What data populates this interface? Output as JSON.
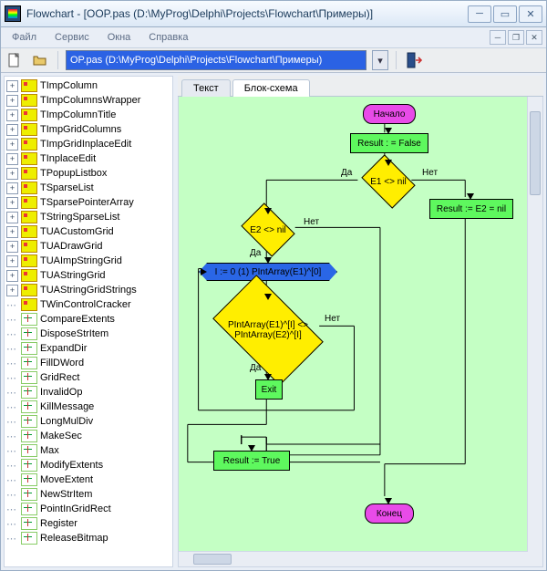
{
  "window": {
    "title": "Flowchart - [OOP.pas (D:\\MyProg\\Delphi\\Projects\\Flowchart\\Примеры)]"
  },
  "menu": {
    "file": "Файл",
    "service": "Сервис",
    "windows": "Окна",
    "help": "Справка"
  },
  "toolbar": {
    "file_selected": "OP.pas (D:\\MyProg\\Delphi\\Projects\\Flowchart\\Примеры)"
  },
  "tabs": {
    "text": "Текст",
    "diagram": "Блок-схема"
  },
  "tree": [
    {
      "type": "cls",
      "exp": true,
      "label": "TImpColumn"
    },
    {
      "type": "cls",
      "exp": true,
      "label": "TImpColumnsWrapper"
    },
    {
      "type": "cls",
      "exp": true,
      "label": "TImpColumnTitle"
    },
    {
      "type": "cls",
      "exp": true,
      "label": "TImpGridColumns"
    },
    {
      "type": "cls",
      "exp": true,
      "label": "TImpGridInplaceEdit"
    },
    {
      "type": "cls",
      "exp": true,
      "label": "TInplaceEdit"
    },
    {
      "type": "cls",
      "exp": true,
      "label": "TPopupListbox"
    },
    {
      "type": "cls",
      "exp": true,
      "label": "TSparseList"
    },
    {
      "type": "cls",
      "exp": true,
      "label": "TSparsePointerArray"
    },
    {
      "type": "cls",
      "exp": true,
      "label": "TStringSparseList"
    },
    {
      "type": "cls",
      "exp": true,
      "label": "TUACustomGrid"
    },
    {
      "type": "cls",
      "exp": true,
      "label": "TUADrawGrid"
    },
    {
      "type": "cls",
      "exp": true,
      "label": "TUAImpStringGrid"
    },
    {
      "type": "cls",
      "exp": true,
      "label": "TUAStringGrid"
    },
    {
      "type": "cls",
      "exp": true,
      "label": "TUAStringGridStrings"
    },
    {
      "type": "cls",
      "exp": false,
      "label": "TWinControlCracker"
    },
    {
      "type": "fn",
      "exp": false,
      "label": "CompareExtents"
    },
    {
      "type": "fn",
      "exp": false,
      "label": "DisposeStrItem"
    },
    {
      "type": "fn",
      "exp": false,
      "label": "ExpandDir"
    },
    {
      "type": "fn",
      "exp": false,
      "label": "FillDWord"
    },
    {
      "type": "fn",
      "exp": false,
      "label": "GridRect"
    },
    {
      "type": "fn",
      "exp": false,
      "label": "InvalidOp"
    },
    {
      "type": "fn",
      "exp": false,
      "label": "KillMessage"
    },
    {
      "type": "fn",
      "exp": false,
      "label": "LongMulDiv"
    },
    {
      "type": "fn",
      "exp": false,
      "label": "MakeSec"
    },
    {
      "type": "fn",
      "exp": false,
      "label": "Max"
    },
    {
      "type": "fn",
      "exp": false,
      "label": "ModifyExtents"
    },
    {
      "type": "fn",
      "exp": false,
      "label": "MoveExtent"
    },
    {
      "type": "fn",
      "exp": false,
      "label": "NewStrItem"
    },
    {
      "type": "fn",
      "exp": false,
      "label": "PointInGridRect"
    },
    {
      "type": "fn",
      "exp": false,
      "label": "Register"
    },
    {
      "type": "fn",
      "exp": false,
      "label": "ReleaseBitmap"
    }
  ],
  "flow": {
    "start": "Начало",
    "result_false": "Result : = False",
    "e1_nil": "E1 <> nil",
    "yes": "Да",
    "no": "Нет",
    "result_e2": "Result := E2 = nil",
    "e2_nil": "E2 <> nil",
    "loop": "I := 0 (1) PIntArray(E1)^[0]",
    "compare": "PIntArray(E1)^[I] <>\nPIntArray(E2)^[I]",
    "exit": "Exit",
    "result_true": "Result := True",
    "end": "Конец"
  }
}
